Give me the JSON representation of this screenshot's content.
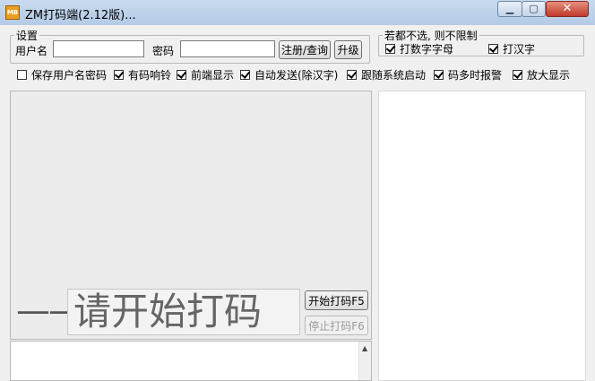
{
  "window": {
    "title": "ZM打码端(2.12版)...",
    "icon": "app-logo-icon",
    "icon_text": "MB",
    "minimize_glyph": "▁",
    "maximize_glyph": "▢",
    "close_glyph": "✕"
  },
  "settings": {
    "legend": "设置",
    "username_label": "用户名",
    "username_value": "",
    "password_label": "密码",
    "password_value": "",
    "register_button": "注册/查询",
    "upgrade_button": "升级"
  },
  "limits": {
    "legend": "若都不选, 则不限制",
    "type_alnum": {
      "label": "打数字字母",
      "checked": true
    },
    "type_hanzi": {
      "label": "打汉字",
      "checked": true
    }
  },
  "options": [
    {
      "label": "保存用户名密码",
      "checked": false
    },
    {
      "label": "有码响铃",
      "checked": true
    },
    {
      "label": "前端显示",
      "checked": true
    },
    {
      "label": "自动发送(除汉字)",
      "checked": true
    },
    {
      "label": "跟随系统启动",
      "checked": true
    },
    {
      "label": "码多时报警",
      "checked": true
    },
    {
      "label": "放大显示",
      "checked": true
    }
  ],
  "main": {
    "dash_text": "——",
    "prompt_text": "请开始打码",
    "start_button": "开始打码F5",
    "stop_button": "停止打码F6"
  }
}
